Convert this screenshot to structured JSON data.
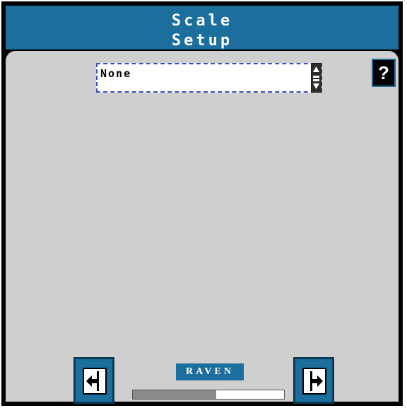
{
  "header": {
    "title_line1": "Scale",
    "title_line2": "Setup"
  },
  "dropdown": {
    "value": "None"
  },
  "help": {
    "label": "?"
  },
  "footer": {
    "logo_text": "RAVEN",
    "progress_fraction": 0.55,
    "back_icon": "arrow-left-icon",
    "next_icon": "arrow-right-icon"
  },
  "colors": {
    "accent": "#1c6f9c",
    "panel": "#cfcfcf",
    "frame": "#000000"
  }
}
